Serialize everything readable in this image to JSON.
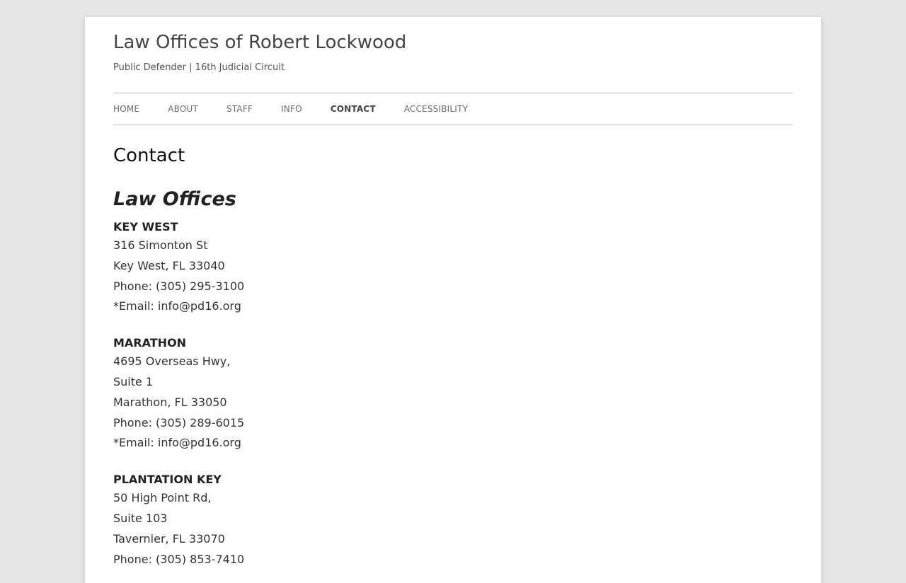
{
  "site": {
    "title": "Law Offices of Robert Lockwood",
    "tagline": "Public Defender | 16th Judicial Circuit"
  },
  "nav": {
    "items": [
      {
        "label": "HOME"
      },
      {
        "label": "ABOUT"
      },
      {
        "label": "STAFF"
      },
      {
        "label": "INFO"
      },
      {
        "label": "CONTACT"
      },
      {
        "label": "ACCESSIBILITY"
      }
    ],
    "current": "CONTACT"
  },
  "page": {
    "title": "Contact"
  },
  "offices_section": {
    "heading": "Law Offices",
    "offices": [
      {
        "name": "KEY WEST",
        "address_lines": [
          "316 Simonton St",
          "Key West, FL 33040"
        ],
        "phone": "Phone: (305) 295-3100",
        "email_prefix": "*Email: ",
        "email": "info@pd16.org"
      },
      {
        "name": "MARATHON",
        "address_lines": [
          "4695 Overseas Hwy,",
          "Suite 1",
          "Marathon, FL 33050"
        ],
        "phone": "Phone: (305) 289-6015",
        "email_prefix": "*Email: ",
        "email": "info@pd16.org"
      },
      {
        "name": "PLANTATION KEY",
        "address_lines": [
          "50 High Point Rd,",
          "Suite 103",
          "Tavernier, FL 33070"
        ],
        "phone": "Phone: (305) 853-7410"
      }
    ]
  }
}
